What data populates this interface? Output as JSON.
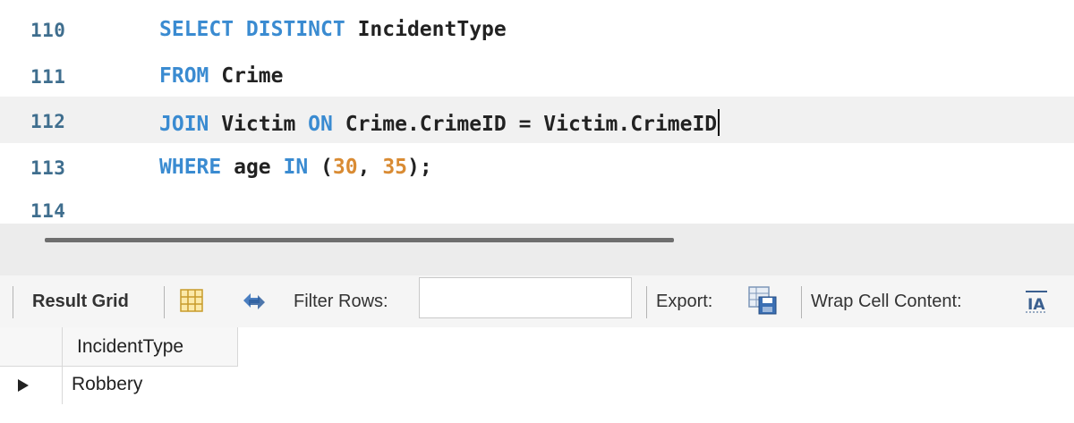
{
  "editor": {
    "lines": [
      {
        "num": "110"
      },
      {
        "num": "111"
      },
      {
        "num": "112"
      },
      {
        "num": "113"
      },
      {
        "num": "114"
      }
    ],
    "tokens": {
      "l110_kw": "SELECT DISTINCT",
      "l110_id": " IncidentType",
      "l111_kw": "FROM",
      "l111_id": " Crime",
      "l112_kw1": "JOIN",
      "l112_id1": " Victim ",
      "l112_kw2": "ON",
      "l112_id2": " Crime.CrimeID = Victim.CrimeID",
      "l113_kw1": "WHERE",
      "l113_id1": " age ",
      "l113_kw2": "IN",
      "l113_p1": " (",
      "l113_n1": "30",
      "l113_c": ", ",
      "l113_n2": "35",
      "l113_p2": ");"
    },
    "colors": {
      "keyword": "#3a8bd1",
      "number": "#d98b33",
      "line_number": "#3f6e8e"
    }
  },
  "toolbar": {
    "result_grid_label": "Result Grid",
    "filter_rows_label": "Filter Rows:",
    "filter_value": "",
    "export_label": "Export:",
    "wrap_label": "Wrap Cell Content:"
  },
  "grid": {
    "columns": [
      "IncidentType"
    ],
    "rows": [
      [
        "Robbery"
      ]
    ]
  }
}
